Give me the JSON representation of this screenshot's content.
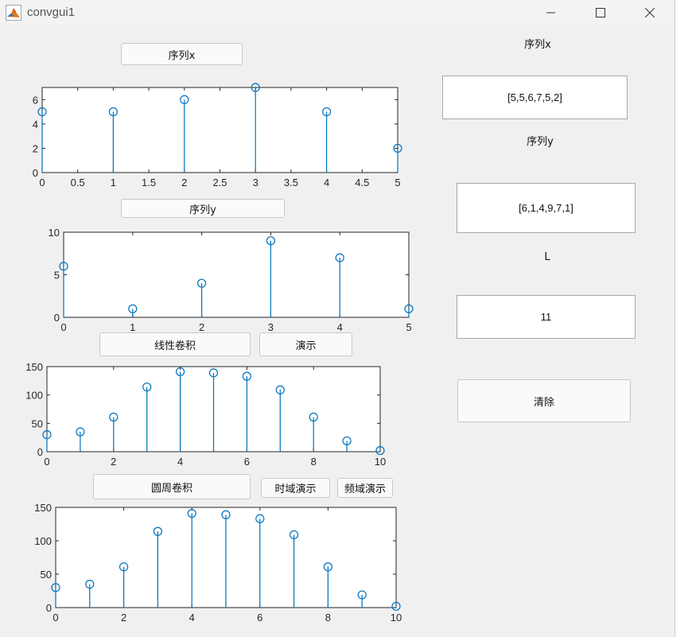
{
  "window": {
    "title": "convgui1",
    "icon": "matlab-logo-icon"
  },
  "buttons": {
    "seq_x": "序列x",
    "seq_y": "序列y",
    "linear_conv": "线性卷积",
    "demo": "演示",
    "circular_conv": "圆周卷积",
    "time_demo": "时域演示",
    "freq_demo": "频域演示",
    "clear": "清除"
  },
  "labels": {
    "seq_x": "序列x",
    "seq_y": "序列y",
    "L": "L"
  },
  "fields": {
    "seq_x_value": "[5,5,6,7,5,2]",
    "seq_y_value": "[6,1,4,9,7,1]",
    "L_value": "11"
  },
  "colors": {
    "stem": "#0072bd",
    "window_bg": "#f0f0f0"
  },
  "chart_data": [
    {
      "type": "stem",
      "name": "seq-x",
      "x": [
        0,
        1,
        2,
        3,
        4,
        5
      ],
      "y": [
        5,
        5,
        6,
        7,
        5,
        2
      ],
      "xlim": [
        0,
        5
      ],
      "ylim": [
        0,
        7
      ],
      "xticks": [
        0,
        0.5,
        1,
        1.5,
        2,
        2.5,
        3,
        3.5,
        4,
        4.5,
        5
      ],
      "xtick_labels": [
        "0",
        "0.5",
        "1",
        "1.5",
        "2",
        "2.5",
        "3",
        "3.5",
        "4",
        "4.5",
        "5"
      ],
      "yticks": [
        0,
        2,
        4,
        6
      ],
      "ytick_labels": [
        "0",
        "2",
        "4",
        "6"
      ]
    },
    {
      "type": "stem",
      "name": "seq-y",
      "x": [
        0,
        1,
        2,
        3,
        4,
        5
      ],
      "y": [
        6,
        1,
        4,
        9,
        7,
        1
      ],
      "xlim": [
        0,
        5
      ],
      "ylim": [
        0,
        10
      ],
      "xticks": [
        0,
        1,
        2,
        3,
        4,
        5
      ],
      "xtick_labels": [
        "0",
        "1",
        "2",
        "3",
        "4",
        "5"
      ],
      "yticks": [
        0,
        5,
        10
      ],
      "ytick_labels": [
        "0",
        "5",
        "10"
      ]
    },
    {
      "type": "stem",
      "name": "linear-conv",
      "x": [
        0,
        1,
        2,
        3,
        4,
        5,
        6,
        7,
        8,
        9,
        10
      ],
      "y": [
        30,
        35,
        61,
        114,
        141,
        139,
        133,
        109,
        61,
        19,
        2
      ],
      "xlim": [
        0,
        10
      ],
      "ylim": [
        0,
        150
      ],
      "xticks": [
        0,
        2,
        4,
        6,
        8,
        10
      ],
      "xtick_labels": [
        "0",
        "2",
        "4",
        "6",
        "8",
        "10"
      ],
      "yticks": [
        0,
        50,
        100,
        150
      ],
      "ytick_labels": [
        "0",
        "50",
        "100",
        "150"
      ]
    },
    {
      "type": "stem",
      "name": "circular-conv",
      "x": [
        0,
        1,
        2,
        3,
        4,
        5,
        6,
        7,
        8,
        9,
        10
      ],
      "y": [
        30,
        35,
        61,
        114,
        141,
        139,
        133,
        109,
        61,
        19,
        2
      ],
      "xlim": [
        0,
        10
      ],
      "ylim": [
        0,
        150
      ],
      "xticks": [
        0,
        2,
        4,
        6,
        8,
        10
      ],
      "xtick_labels": [
        "0",
        "2",
        "4",
        "6",
        "8",
        "10"
      ],
      "yticks": [
        0,
        50,
        100,
        150
      ],
      "ytick_labels": [
        "0",
        "50",
        "100",
        "150"
      ]
    }
  ]
}
